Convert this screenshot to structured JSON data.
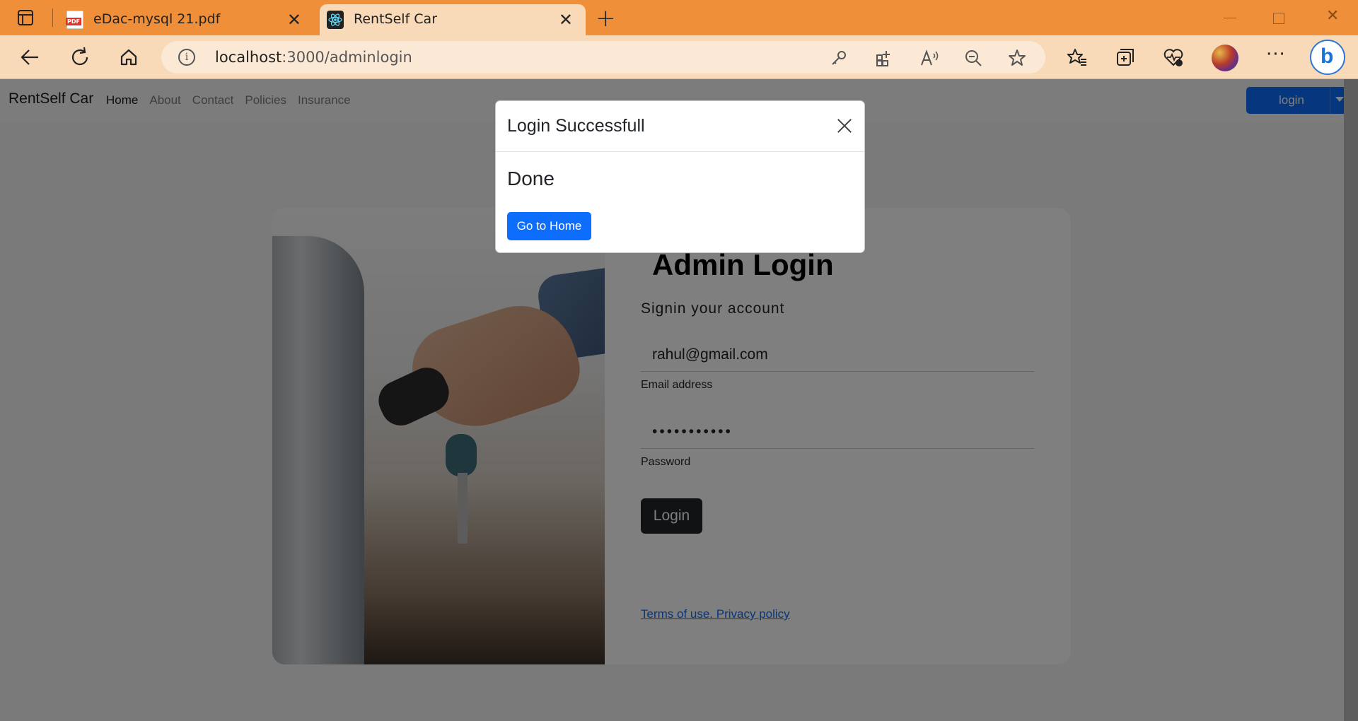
{
  "browser": {
    "tabs": [
      {
        "title": "eDac-mysql 21.pdf",
        "favicon": "pdf-icon",
        "active": false
      },
      {
        "title": "RentSelf Car",
        "favicon": "react-icon",
        "active": true
      }
    ],
    "url_host": "localhost",
    "url_path": ":3000/adminlogin",
    "accent_color": "#ef8f3a"
  },
  "navbar": {
    "brand": "RentSelf Car",
    "links": [
      "Home",
      "About",
      "Contact",
      "Policies",
      "Insurance"
    ],
    "active_link": "Home",
    "login_button": "login"
  },
  "login_card": {
    "title": "Admin Login",
    "subtitle": "Signin your account",
    "email_value": "rahul@gmail.com",
    "email_label": "Email address",
    "password_value": "•••••••••••",
    "password_label": "Password",
    "submit_label": "Login",
    "terms_link": "Terms of use. Privacy policy"
  },
  "modal": {
    "title": "Login Successfull",
    "body": "Done",
    "button": "Go to Home"
  }
}
